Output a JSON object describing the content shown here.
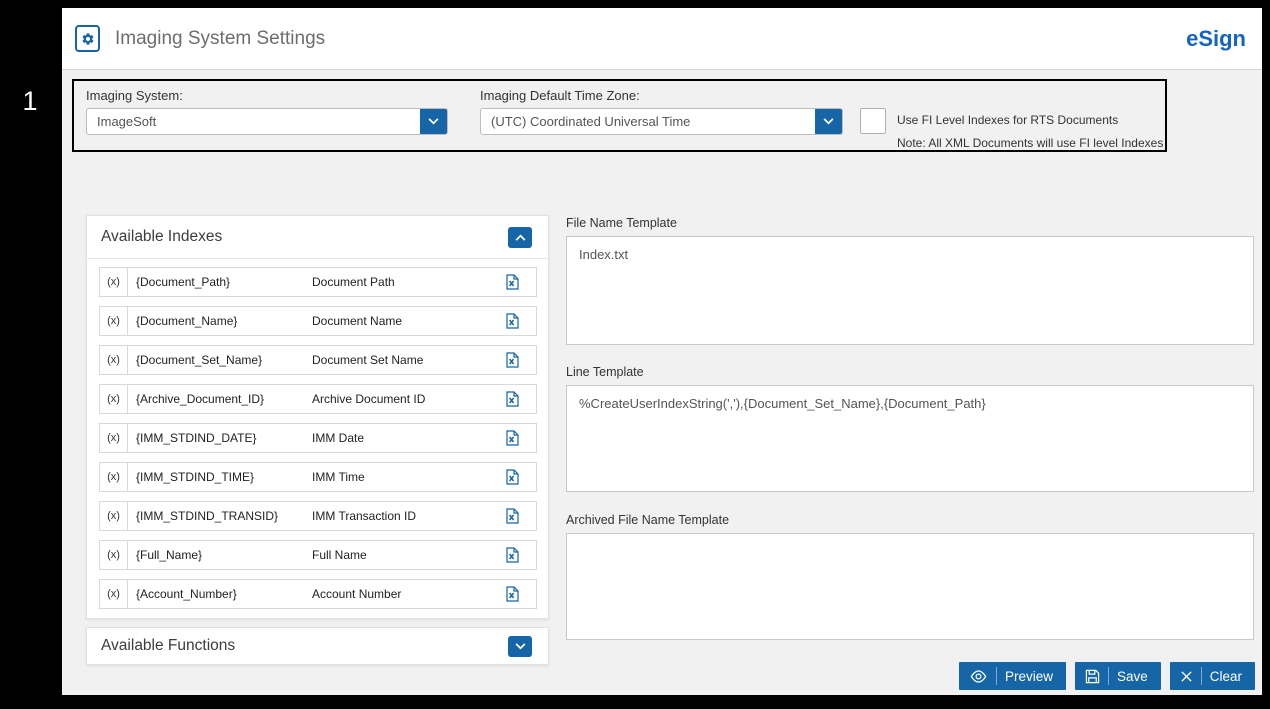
{
  "header": {
    "title": "Imaging System Settings",
    "brand": "eSign"
  },
  "callout": {
    "number": "1"
  },
  "settings": {
    "imaging_system_label": "Imaging System:",
    "imaging_system_value": "ImageSoft",
    "time_zone_label": "Imaging Default Time Zone:",
    "time_zone_value": "(UTC) Coordinated Universal Time",
    "fi_checkbox_label": "Use FI Level Indexes for RTS Documents",
    "fi_checkbox_checked": false,
    "note": "Note: All XML Documents will use FI level Indexes"
  },
  "indexes_panel": {
    "title": "Available Indexes",
    "rows": [
      {
        "prefix": "(x)",
        "token": "{Document_Path}",
        "name": "Document Path"
      },
      {
        "prefix": "(x)",
        "token": "{Document_Name}",
        "name": "Document Name"
      },
      {
        "prefix": "(x)",
        "token": "{Document_Set_Name}",
        "name": "Document Set Name"
      },
      {
        "prefix": "(x)",
        "token": "{Archive_Document_ID}",
        "name": "Archive Document ID"
      },
      {
        "prefix": "(x)",
        "token": "{IMM_STDIND_DATE}",
        "name": "IMM Date"
      },
      {
        "prefix": "(x)",
        "token": "{IMM_STDIND_TIME}",
        "name": "IMM Time"
      },
      {
        "prefix": "(x)",
        "token": "{IMM_STDIND_TRANSID}",
        "name": "IMM Transaction ID"
      },
      {
        "prefix": "(x)",
        "token": "{Full_Name}",
        "name": "Full Name"
      },
      {
        "prefix": "(x)",
        "token": "{Account_Number}",
        "name": "Account Number"
      }
    ]
  },
  "functions_panel": {
    "title": "Available Functions"
  },
  "templates": {
    "file_name_label": "File Name Template",
    "file_name_value": "Index.txt",
    "line_label": "Line Template",
    "line_value": "%CreateUserIndexString(','),{Document_Set_Name},{Document_Path}",
    "archived_label": "Archived File Name Template",
    "archived_value": ""
  },
  "actions": {
    "preview": "Preview",
    "save": "Save",
    "clear": "Clear"
  },
  "colors": {
    "accent": "#1565a7",
    "brand": "#1565c0"
  }
}
